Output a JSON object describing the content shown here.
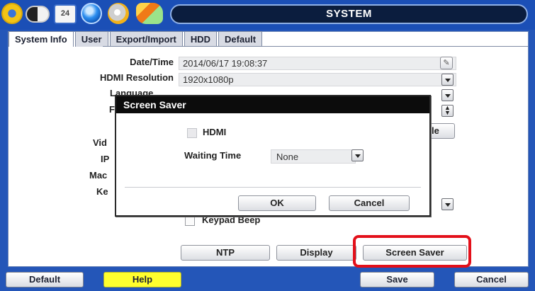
{
  "window": {
    "title": "SYSTEM"
  },
  "toolbar_icons": [
    "gear-icon",
    "toggle-icon",
    "calendar-icon",
    "network-globe-icon",
    "record-disc-icon",
    "event-icon"
  ],
  "calendar_text": "24",
  "tabs": [
    {
      "label": "System Info",
      "active": true
    },
    {
      "label": "User",
      "active": false
    },
    {
      "label": "Export/Import",
      "active": false
    },
    {
      "label": "HDD",
      "active": false
    },
    {
      "label": "Default",
      "active": false
    }
  ],
  "system_info": {
    "datetime_label": "Date/Time",
    "datetime_value": "2014/06/17 19:08:37",
    "hdmi_label": "HDMI Resolution",
    "hdmi_value": "1920x1080p",
    "language_label": "Language",
    "partial_label_f": "F",
    "partial_label_vid": "Vid",
    "partial_label_ip": "IP",
    "partial_label_mac": "Mac",
    "partial_label_key": "Ke",
    "partial_btn_le": "le",
    "keypad_beep_label": "Keypad Beep"
  },
  "panel_buttons": {
    "ntp": "NTP",
    "display": "Display",
    "screen_saver": "Screen Saver"
  },
  "modal": {
    "title": "Screen Saver",
    "hdmi_label": "HDMI",
    "hdmi_checked": false,
    "waiting_time_label": "Waiting Time",
    "waiting_time_value": "None",
    "ok_label": "OK",
    "cancel_label": "Cancel"
  },
  "bottom": {
    "default_label": "Default",
    "help_label": "Help",
    "save_label": "Save",
    "cancel_label": "Cancel"
  },
  "colors": {
    "background_blue": "#2456b8",
    "help_yellow": "#ffff2e",
    "highlight_red": "#e3101a",
    "modal_titlebar": "#0c0c0c"
  }
}
